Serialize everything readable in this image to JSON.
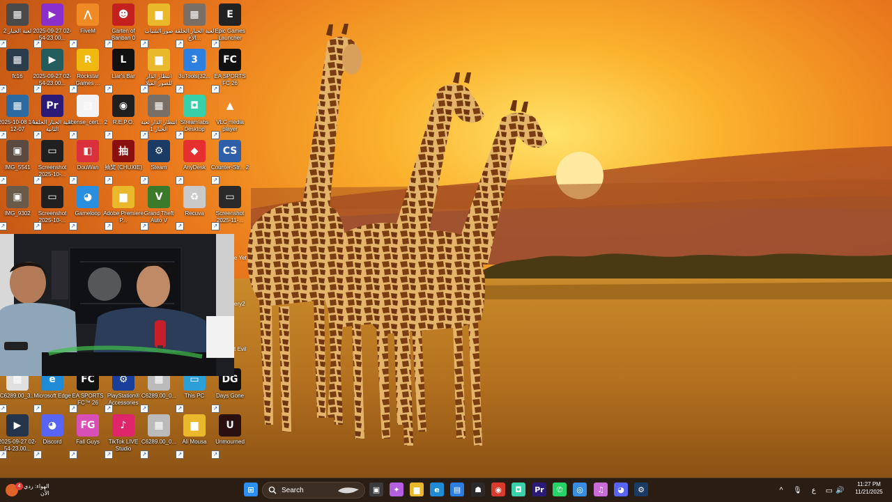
{
  "desktop": {
    "icons": [
      {
        "label": "لعبة الحبار 2",
        "color": "#4a4a4a",
        "glyph": "▦"
      },
      {
        "label": "2025-09-27 02-54-23.00...",
        "color": "#8a2fc9",
        "glyph": "▶"
      },
      {
        "label": "FiveM",
        "color": "#f08a24",
        "glyph": "⋀"
      },
      {
        "label": "Garten of Banban 0",
        "color": "#c42020",
        "glyph": "☻"
      },
      {
        "label": "صور الشباب",
        "color": "#e9b92b",
        "glyph": "▆"
      },
      {
        "label": "لعبة الحبار الحلقة الأخ...",
        "color": "#7a6f66",
        "glyph": "▦"
      },
      {
        "label": "Epic Games Launcher",
        "color": "#222222",
        "glyph": "E"
      },
      {
        "label": "fc16",
        "color": "#2b3d4c",
        "glyph": "▦"
      },
      {
        "label": "2025-09-27 02-54-23.00...",
        "color": "#235c5c",
        "glyph": "▶"
      },
      {
        "label": "Rockstar Games ...",
        "color": "#f0b90f",
        "glyph": "R"
      },
      {
        "label": "Liar's Bar",
        "color": "#111111",
        "glyph": "L"
      },
      {
        "label": "انتظار الدار للصور الفيلا",
        "color": "#e9b92b",
        "glyph": "▆"
      },
      {
        "label": "3uTools(32...",
        "color": "#2d7fe0",
        "glyph": "3"
      },
      {
        "label": "EA SPORTS FC 26",
        "color": "#111111",
        "glyph": "FC"
      },
      {
        "label": "2025-10-08 14-12-07",
        "color": "#2d6aa0",
        "glyph": "▦"
      },
      {
        "label": "لعبة الحبار الحلقة الثانية",
        "color": "#2b1a78",
        "glyph": "Pr"
      },
      {
        "label": "license_cert... 2",
        "color": "#f3f3f3",
        "glyph": "▤"
      },
      {
        "label": "R.E.P.O.",
        "color": "#1f1f1f",
        "glyph": "◉"
      },
      {
        "label": "انتظار الدار لعبة الحبار 1",
        "color": "#7a6f66",
        "glyph": "▦"
      },
      {
        "label": "Streamlabs Desktop",
        "color": "#37d0a8",
        "glyph": "◘"
      },
      {
        "label": "VLC media player",
        "color": "#f08a24",
        "glyph": "▲"
      },
      {
        "label": "IMG_5541",
        "color": "#5a4a40",
        "glyph": "▣"
      },
      {
        "label": "Screenshot 2025-10-...",
        "color": "#202020",
        "glyph": "▭"
      },
      {
        "label": "DouWan",
        "color": "#d9303b",
        "glyph": "◧"
      },
      {
        "label": "抽奖 (CHUXIE)",
        "color": "#8a1010",
        "glyph": "抽"
      },
      {
        "label": "Steam",
        "color": "#1b3b64",
        "glyph": "⚙"
      },
      {
        "label": "AnyDesk",
        "color": "#e6302f",
        "glyph": "◆"
      },
      {
        "label": "Counter-Str... 2",
        "color": "#2f5fa8",
        "glyph": "CS"
      },
      {
        "label": "IMG_9302",
        "color": "#6a5a4a",
        "glyph": "▣"
      },
      {
        "label": "Screenshot 2025-10-...",
        "color": "#202020",
        "glyph": "▭"
      },
      {
        "label": "Gameloop",
        "color": "#2b8fe0",
        "glyph": "◕"
      },
      {
        "label": "Adobe Premiere P...",
        "color": "#e9b92b",
        "glyph": "▆"
      },
      {
        "label": "Grand Theft Auto V",
        "color": "#3a7a2a",
        "glyph": "V"
      },
      {
        "label": "Recuva",
        "color": "#c9c9c9",
        "glyph": "♻"
      },
      {
        "label": "Screenshot 2025-11-...",
        "color": "#2a2a2a",
        "glyph": "▭"
      },
      {
        "label": "C6289.00_3...",
        "color": "#e0e0e0",
        "glyph": "▦"
      },
      {
        "label": "Microsoft Edge",
        "color": "#1f8ad6",
        "glyph": "e"
      },
      {
        "label": "EA SPORTS FC™ 26",
        "color": "#111111",
        "glyph": "FC"
      },
      {
        "label": "PlayStation® Accessories",
        "color": "#1a3f9a",
        "glyph": "⚙"
      },
      {
        "label": "C6289.00_0...",
        "color": "#bbbbbb",
        "glyph": "▦"
      },
      {
        "label": "This PC",
        "color": "#2b9fd6",
        "glyph": "▭"
      },
      {
        "label": "Days Gone",
        "color": "#111111",
        "glyph": "DG"
      },
      {
        "label": "2025-09-27 02-54-23.00...",
        "color": "#24344a",
        "glyph": "▶"
      },
      {
        "label": "Discord",
        "color": "#5865f2",
        "glyph": "◕"
      },
      {
        "label": "Fall Guys",
        "color": "#d84fb8",
        "glyph": "FG"
      },
      {
        "label": "TikTok LIVE Studio",
        "color": "#e0266a",
        "glyph": "♪"
      },
      {
        "label": "C6289.00_0...",
        "color": "#bbbbbb",
        "glyph": "▦"
      },
      {
        "label": "Ali Mousa",
        "color": "#e9b92b",
        "glyph": "▆"
      },
      {
        "label": "Unmourned",
        "color": "#2a1010",
        "glyph": "U"
      }
    ],
    "partial_labels": [
      "e Yet",
      "ery2",
      "t Evil"
    ]
  },
  "taskbar": {
    "widget": {
      "badge": "4",
      "line1": "الهواء: ردي",
      "line2": "الآن"
    },
    "search": {
      "placeholder": "Search"
    },
    "apps": [
      {
        "name": "start",
        "color": "#2b8ef0",
        "glyph": "⊞"
      },
      {
        "name": "task-view",
        "color": "#3a3a3a",
        "glyph": "▣"
      },
      {
        "name": "copilot",
        "color": "#b35fe0",
        "glyph": "✦"
      },
      {
        "name": "file-explorer",
        "color": "#e9b92b",
        "glyph": "▆"
      },
      {
        "name": "edge",
        "color": "#1f8ad6",
        "glyph": "e"
      },
      {
        "name": "store",
        "color": "#2b7de0",
        "glyph": "▤"
      },
      {
        "name": "alien",
        "color": "#2a2a2a",
        "glyph": "☗"
      },
      {
        "name": "chrome",
        "color": "#d93a2b",
        "glyph": "◉"
      },
      {
        "name": "streamlabs",
        "color": "#37d0a8",
        "glyph": "◘"
      },
      {
        "name": "premiere",
        "color": "#2b1a78",
        "glyph": "Pr"
      },
      {
        "name": "whatsapp",
        "color": "#25d366",
        "glyph": "✆"
      },
      {
        "name": "browser",
        "color": "#3a8ee0",
        "glyph": "◎"
      },
      {
        "name": "itunes",
        "color": "#c96bd9",
        "glyph": "♫"
      },
      {
        "name": "discord",
        "color": "#5865f2",
        "glyph": "◕"
      },
      {
        "name": "steam",
        "color": "#1b3b64",
        "glyph": "⚙"
      }
    ],
    "tray": {
      "chevron": "^",
      "mic": "🎙",
      "lang": "ع",
      "network": "▭",
      "volume": "🔊"
    },
    "clock": {
      "time": "11:27 PM",
      "date": "11/21/2025"
    }
  }
}
